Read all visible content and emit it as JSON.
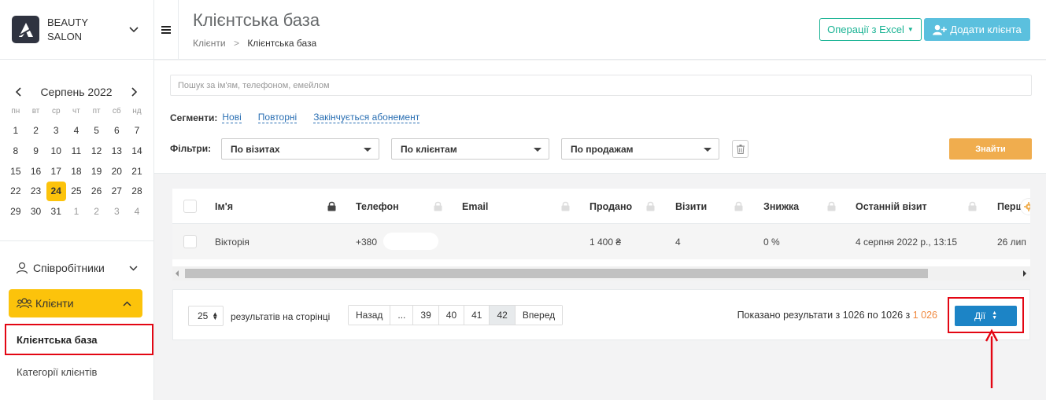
{
  "brand": {
    "name_line1": "BEAUTY",
    "name_line2": "SALON"
  },
  "calendar": {
    "month": "Серпень 2022",
    "weekdays": [
      "пн",
      "вт",
      "ср",
      "чт",
      "пт",
      "сб",
      "нд"
    ],
    "days": [
      {
        "d": "1"
      },
      {
        "d": "2"
      },
      {
        "d": "3"
      },
      {
        "d": "4"
      },
      {
        "d": "5"
      },
      {
        "d": "6"
      },
      {
        "d": "7"
      },
      {
        "d": "8"
      },
      {
        "d": "9"
      },
      {
        "d": "10"
      },
      {
        "d": "11"
      },
      {
        "d": "12"
      },
      {
        "d": "13"
      },
      {
        "d": "14"
      },
      {
        "d": "15"
      },
      {
        "d": "16"
      },
      {
        "d": "17"
      },
      {
        "d": "18"
      },
      {
        "d": "19"
      },
      {
        "d": "20"
      },
      {
        "d": "21"
      },
      {
        "d": "22"
      },
      {
        "d": "23"
      },
      {
        "d": "24",
        "today": true
      },
      {
        "d": "25"
      },
      {
        "d": "26"
      },
      {
        "d": "27"
      },
      {
        "d": "28"
      },
      {
        "d": "29"
      },
      {
        "d": "30"
      },
      {
        "d": "31"
      },
      {
        "d": "1",
        "other": true
      },
      {
        "d": "2",
        "other": true
      },
      {
        "d": "3",
        "other": true
      },
      {
        "d": "4",
        "other": true
      }
    ]
  },
  "nav": {
    "staff": "Співробітники",
    "clients": "Клієнти",
    "client_base": "Клієнтська база",
    "client_categories": "Категорії клієнтів"
  },
  "header": {
    "title": "Клієнтська база",
    "breadcrumb_root": "Клієнти",
    "breadcrumb_sep": ">",
    "breadcrumb_current": "Клієнтська база",
    "excel_label": "Операції з Excel",
    "add_client_label": "Додати клієнта"
  },
  "search": {
    "placeholder": "Пошук за ім'ям, телефоном, емейлом"
  },
  "segments": {
    "label": "Сегменти:",
    "items": [
      "Нові",
      "Повторні",
      "Закінчується абонемент"
    ]
  },
  "filters": {
    "label": "Фільтри:",
    "visits": "По візитах",
    "clients": "По клієнтам",
    "sales": "По продажам",
    "find_label": "Знайти"
  },
  "table": {
    "headers": {
      "name": "Ім'я",
      "phone": "Телефон",
      "email": "Email",
      "sold": "Продано",
      "visits": "Візити",
      "discount": "Знижка",
      "last_visit": "Останній візит",
      "first_visit": "Перш"
    },
    "rows": [
      {
        "name": "Вікторія",
        "phone": "+380",
        "email": "",
        "sold": "1 400 ₴",
        "visits": "4",
        "discount": "0 %",
        "last_visit": "4 серпня 2022 р., 13:15",
        "first_visit": "26 лип"
      }
    ]
  },
  "pagination": {
    "per_page": "25",
    "per_page_label": "результатів на сторінці",
    "pages": [
      "Назад",
      "...",
      "39",
      "40",
      "41",
      "42",
      "Вперед"
    ],
    "active_page": "42",
    "results_prefix": "Показано результати з 1026 по 1026 з",
    "results_total": "1 026",
    "actions_label": "Дії"
  },
  "colors": {
    "accent_yellow": "#fcc30b",
    "annotation_red": "#e30613",
    "primary_blue": "#1c84c6",
    "teal": "#1ab394"
  }
}
